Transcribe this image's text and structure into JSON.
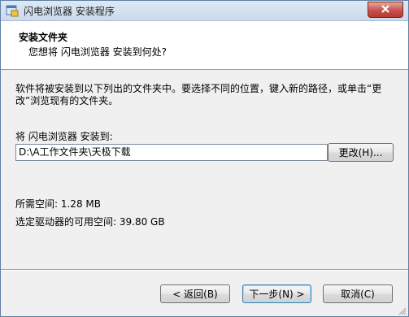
{
  "window": {
    "title": "闪电浏览器 安装程序",
    "icon": "installer-app-icon",
    "close_icon": "close-icon"
  },
  "header": {
    "title": "安装文件夹",
    "subtitle": "您想将 闪电浏览器 安装到何处?"
  },
  "body": {
    "description": "软件将被安装到以下列出的文件夹中。要选择不同的位置，键入新的路径，或单击“更改”浏览现有的文件夹。",
    "install_label": "将 闪电浏览器 安装到:",
    "install_path": "D:\\A工作文件夹\\天极下载",
    "browse_button": "更改(H)...",
    "required_space": "所需空间: 1.28 MB",
    "available_space": "选定驱动器的可用空间: 39.80 GB"
  },
  "footer": {
    "back_button": "< 返回(B)",
    "next_button": "下一步(N) >",
    "cancel_button": "取消(C)"
  }
}
